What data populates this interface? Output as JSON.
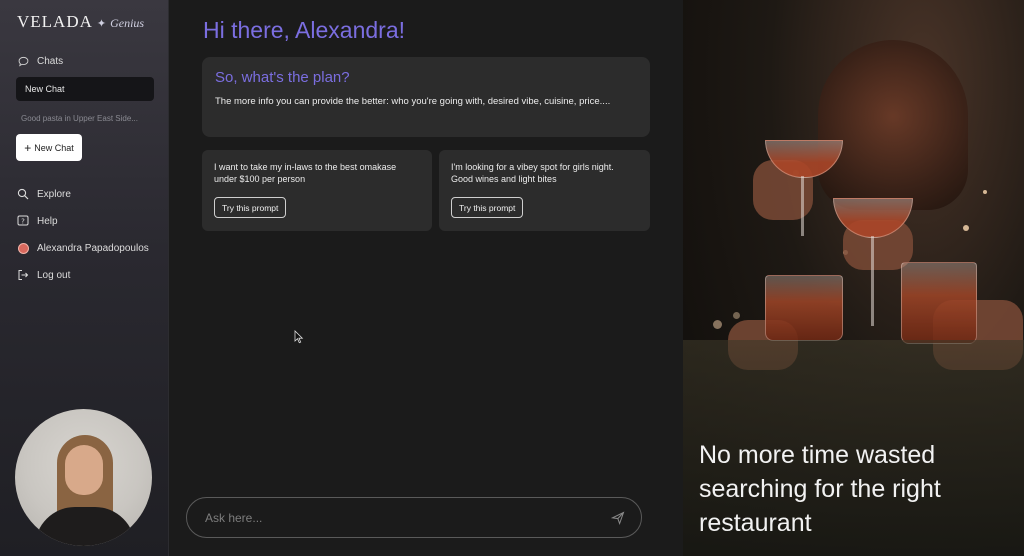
{
  "brand": {
    "name": "VELADA",
    "sub": "Genius"
  },
  "sidebar": {
    "chats_label": "Chats",
    "new_chat_item": "New Chat",
    "recent_chat": "Good pasta in Upper East Side...",
    "new_chat_button": "New Chat",
    "nav": [
      {
        "label": "Explore",
        "icon": "search-icon"
      },
      {
        "label": "Help",
        "icon": "help-icon"
      },
      {
        "label": "Alexandra Papadopoulos",
        "icon": "avatar"
      },
      {
        "label": "Log out",
        "icon": "logout-icon"
      }
    ]
  },
  "main": {
    "greeting": "Hi there, Alexandra!",
    "plan": {
      "title": "So, what's the plan?",
      "text": "The more info you can provide the better: who you're going with, desired vibe, cuisine, price...."
    },
    "prompts": [
      {
        "text": "I want to take my in-laws to the best omakase under $100 per person",
        "button": "Try this prompt"
      },
      {
        "text": "I'm looking for a vibey spot for girls night. Good wines and light bites",
        "button": "Try this prompt"
      }
    ],
    "input": {
      "placeholder": "Ask here..."
    }
  },
  "hero": {
    "tagline": "No more time wasted searching for the right restaurant"
  },
  "colors": {
    "accent": "#7b6ee0",
    "background": "#1b1b1b",
    "card": "#2c2c2c"
  }
}
